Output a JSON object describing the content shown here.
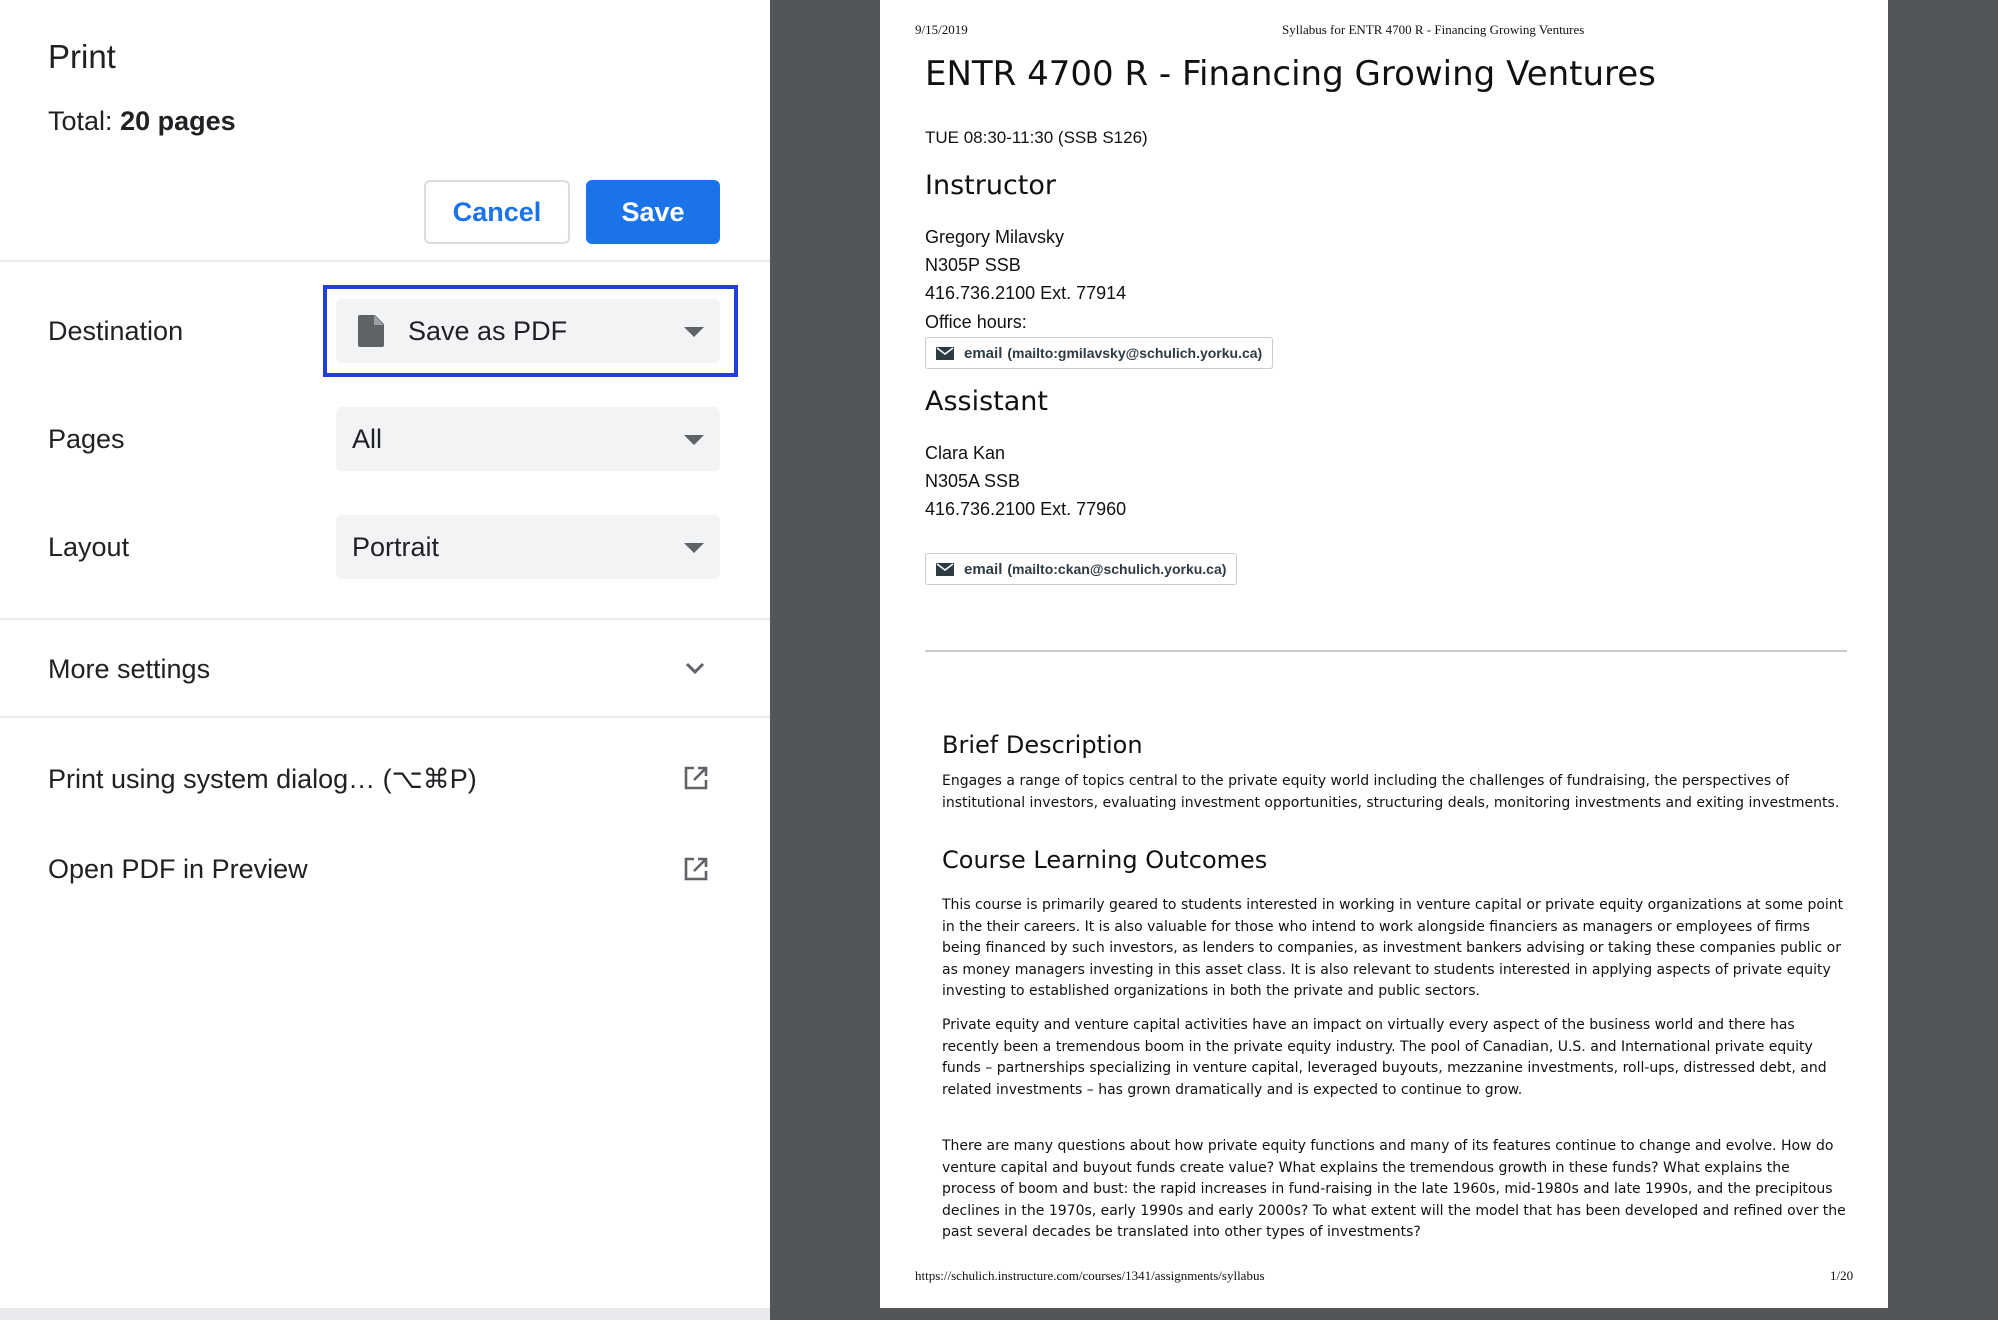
{
  "settings": {
    "title": "Print",
    "total_label": "Total:",
    "total_value": "20 pages",
    "cancel_label": "Cancel",
    "save_label": "Save",
    "destination_label": "Destination",
    "destination_value": "Save as PDF",
    "pages_label": "Pages",
    "pages_value": "All",
    "layout_label": "Layout",
    "layout_value": "Portrait",
    "more_settings_label": "More settings",
    "system_dialog_label": "Print using system dialog… (⌥⌘P)",
    "open_pdf_label": "Open PDF in Preview",
    "accent_color": "#1a73e8"
  },
  "preview": {
    "header_date": "9/15/2019",
    "header_title": "Syllabus for ENTR 4700 R - Financing Growing Ventures",
    "course_title": "ENTR 4700 R - Financing Growing Ventures",
    "schedule": "TUE 08:30-11:30 (SSB S126)",
    "instructor_heading": "Instructor",
    "instructor_name": "Gregory Milavsky",
    "instructor_office": "N305P SSB",
    "instructor_phone": "416.736.2100 Ext. 77914",
    "office_hours": "Office hours:",
    "instructor_email_label": "email",
    "instructor_email_addr": "(mailto:gmilavsky@schulich.yorku.ca)",
    "assistant_heading": "Assistant",
    "assistant_name": "Clara Kan",
    "assistant_office": "N305A SSB",
    "assistant_phone": "416.736.2100 Ext. 77960",
    "assistant_email_label": "email",
    "assistant_email_addr": "(mailto:ckan@schulich.yorku.ca)",
    "brief_heading": "Brief Description",
    "brief_text": "Engages a range of topics central to the private equity world including the challenges of fundraising, the perspectives of institutional investors, evaluating investment opportunities, structuring deals, monitoring investments and exiting investments.",
    "outcomes_heading": "Course Learning Outcomes",
    "outcomes_p1": "This course is primarily geared to students interested in working in venture capital or private equity organizations at some point in the their careers.  It is also valuable for those who intend to work alongside financiers as managers or employees of firms being financed by such investors, as lenders to companies, as investment bankers advising or taking these companies public or as money managers investing in this asset class. It is also relevant to students interested in applying aspects of private equity investing to established organizations in both the private and public sectors.",
    "outcomes_p2": "Private equity and venture capital activities have an impact on virtually every aspect of the business world and there has recently been a tremendous boom in the private equity industry. The pool of Canadian, U.S. and International private equity funds – partnerships specializing in venture capital, leveraged buyouts, mezzanine investments, roll-ups, distressed debt, and related investments – has grown dramatically and is expected to continue to grow.",
    "outcomes_p3": "There are many questions about how private equity functions and many of its features continue to change and evolve.  How do venture capital and buyout funds create value?  What explains the tremendous growth in these funds? What explains the process of boom and bust:  the rapid increases in fund-raising in the late 1960s, mid-1980s and late 1990s, and the precipitous declines in the 1970s, early 1990s and early 2000s? To what extent will the model that has been developed and refined over the past several decades be translated into other types of investments?",
    "footer_url": "https://schulich.instructure.com/courses/1341/assignments/syllabus",
    "footer_page": "1/20"
  }
}
